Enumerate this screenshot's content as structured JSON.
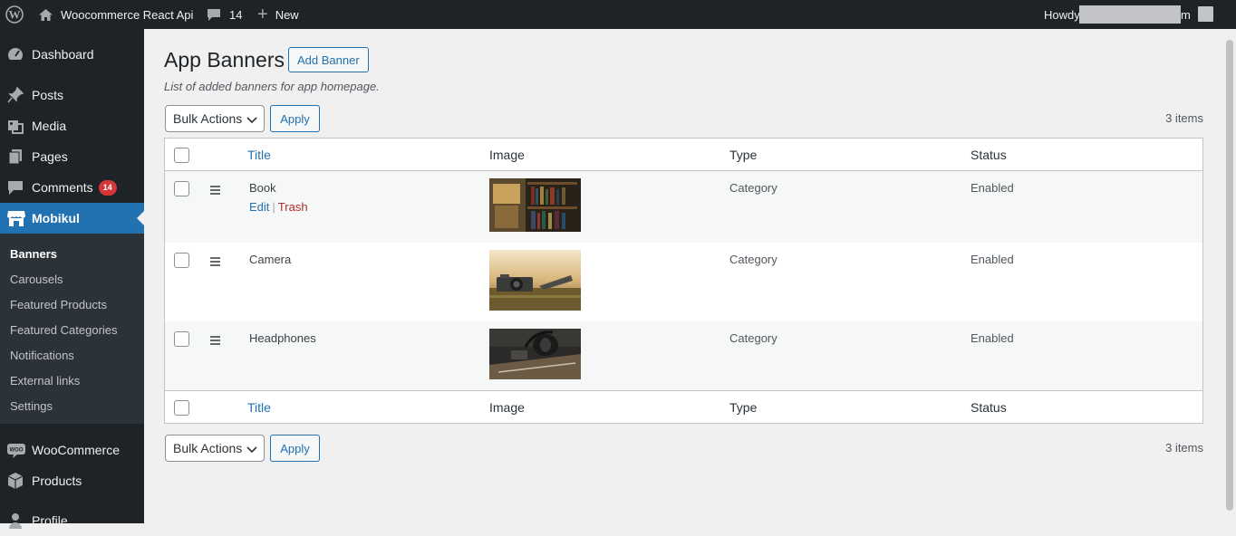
{
  "adminbar": {
    "site_name": "Woocommerce React Api",
    "comments_count": "14",
    "new_label": "New",
    "howdy": "Howdy",
    "howdy_tail": "m"
  },
  "sidebar": {
    "items": [
      {
        "label": "Dashboard",
        "icon": "dashboard-icon"
      },
      {
        "label": "Posts",
        "icon": "pin-icon"
      },
      {
        "label": "Media",
        "icon": "media-icon"
      },
      {
        "label": "Pages",
        "icon": "pages-icon"
      },
      {
        "label": "Comments",
        "icon": "comment-icon",
        "badge": "14"
      },
      {
        "label": "Mobikul",
        "icon": "store-icon"
      },
      {
        "label": "WooCommerce",
        "icon": "woo-icon"
      },
      {
        "label": "Products",
        "icon": "box-icon"
      },
      {
        "label": "Profile",
        "icon": "user-icon"
      }
    ],
    "submenu": [
      "Banners",
      "Carousels",
      "Featured Products",
      "Featured Categories",
      "Notifications",
      "External links",
      "Settings"
    ]
  },
  "page": {
    "title": "App Banners",
    "add_button": "Add Banner",
    "description": "List of added banners for app homepage.",
    "bulk_actions": "Bulk Actions",
    "apply": "Apply",
    "items_count": "3 items"
  },
  "table": {
    "columns": [
      "Title",
      "Image",
      "Type",
      "Status"
    ],
    "rows": [
      {
        "title": "Book",
        "type": "Category",
        "status": "Enabled",
        "image": "bookshelf photo"
      },
      {
        "title": "Camera",
        "type": "Category",
        "status": "Enabled",
        "image": "vintage camera photo"
      },
      {
        "title": "Headphones",
        "type": "Category",
        "status": "Enabled",
        "image": "headphones photo"
      }
    ],
    "row_actions": {
      "edit": "Edit",
      "trash": "Trash"
    }
  },
  "colors": {
    "admin_dark": "#1d2327",
    "accent": "#2271b1",
    "badge": "#d63638",
    "trash": "#b32d2e"
  }
}
